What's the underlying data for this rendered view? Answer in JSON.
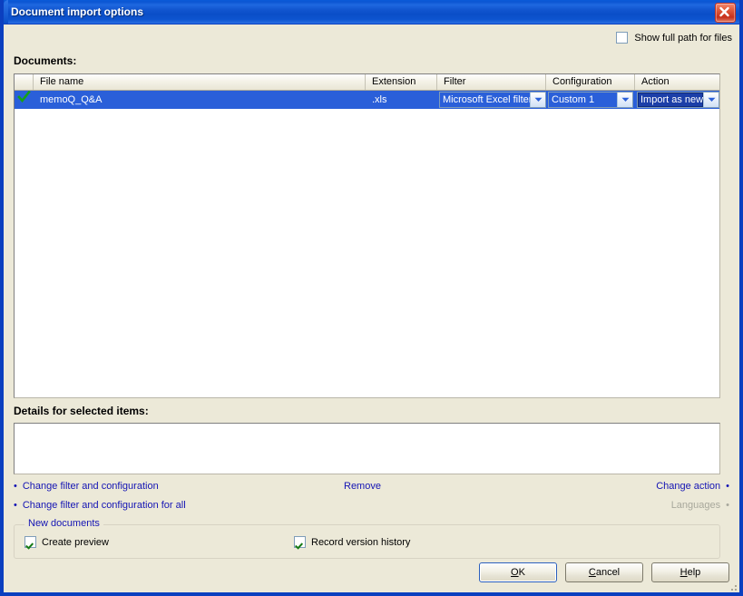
{
  "window": {
    "title": "Document import options",
    "close_icon": "close-icon"
  },
  "header": {
    "documents_label": "Documents:",
    "show_full_path_label": "Show full path for files",
    "show_full_path_checked": false
  },
  "list": {
    "columns": [
      {
        "key": "check",
        "label": ""
      },
      {
        "key": "name",
        "label": "File name"
      },
      {
        "key": "ext",
        "label": "Extension"
      },
      {
        "key": "filter",
        "label": "Filter"
      },
      {
        "key": "config",
        "label": "Configuration"
      },
      {
        "key": "action",
        "label": "Action"
      }
    ],
    "rows": [
      {
        "selected": true,
        "checked": true,
        "name": "memoQ_Q&A",
        "ext": ".xls",
        "filter": "Microsoft Excel filter",
        "config": "Custom 1",
        "action": "Import as new"
      }
    ]
  },
  "details": {
    "label": "Details for selected items:",
    "content": ""
  },
  "links": {
    "change_filter_config": "Change filter and configuration",
    "change_filter_config_all": "Change filter and configuration for all",
    "remove": "Remove",
    "change_action": "Change action",
    "languages": "Languages",
    "languages_disabled": true
  },
  "new_documents": {
    "group_title": "New documents",
    "create_preview_label": "Create preview",
    "create_preview_checked": true,
    "record_version_history_label": "Record version history",
    "record_version_history_checked": true
  },
  "buttons": {
    "ok": {
      "pre": "",
      "mnem": "O",
      "post": "K"
    },
    "cancel": {
      "pre": "",
      "mnem": "C",
      "post": "ancel"
    },
    "help": {
      "pre": "",
      "mnem": "H",
      "post": "elp"
    }
  },
  "colors": {
    "titlebar_blue": "#0b56d2",
    "selection_blue": "#2a5fd9",
    "link_blue": "#1414b4",
    "face": "#ece9d8",
    "check_green": "#157a15",
    "disabled_grey": "#a8a89c"
  }
}
